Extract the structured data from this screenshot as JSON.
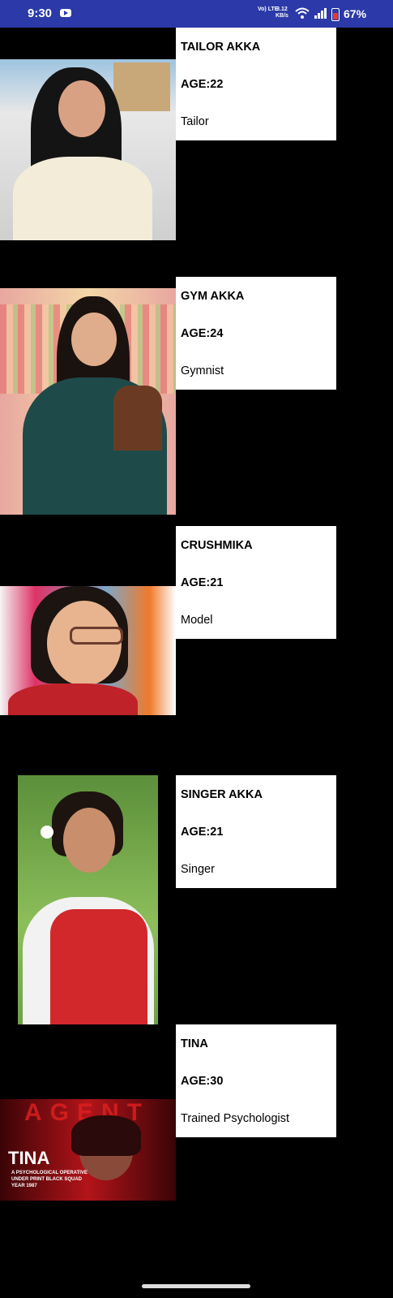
{
  "status_bar": {
    "time": "9:30",
    "network_line1": "Vo) LTE",
    "speed_value": "3.12",
    "speed_unit": "KB/s",
    "battery_percent": "67%",
    "battery_level": 0.67
  },
  "profiles": [
    {
      "name": "TAILOR AKKA",
      "age": "AGE:22",
      "occupation": "Tailor"
    },
    {
      "name": "GYM AKKA",
      "age": "AGE:24",
      "occupation": "Gymnist"
    },
    {
      "name": "CRUSHMIKA",
      "age": "AGE:21",
      "occupation": "Model"
    },
    {
      "name": "SINGER AKKA",
      "age": "AGE:21",
      "occupation": "Singer"
    },
    {
      "name": "TINA",
      "age": "AGE:30",
      "occupation": "Trained Psychologist"
    }
  ],
  "poster": {
    "title_top": "AGENT",
    "title_main": "TINA",
    "line1": "A PSYCHOLOGICAL OPERATIVE",
    "line2": "UNDER PRINT BLACK SQUAD",
    "line3": "YEAR 1987"
  }
}
